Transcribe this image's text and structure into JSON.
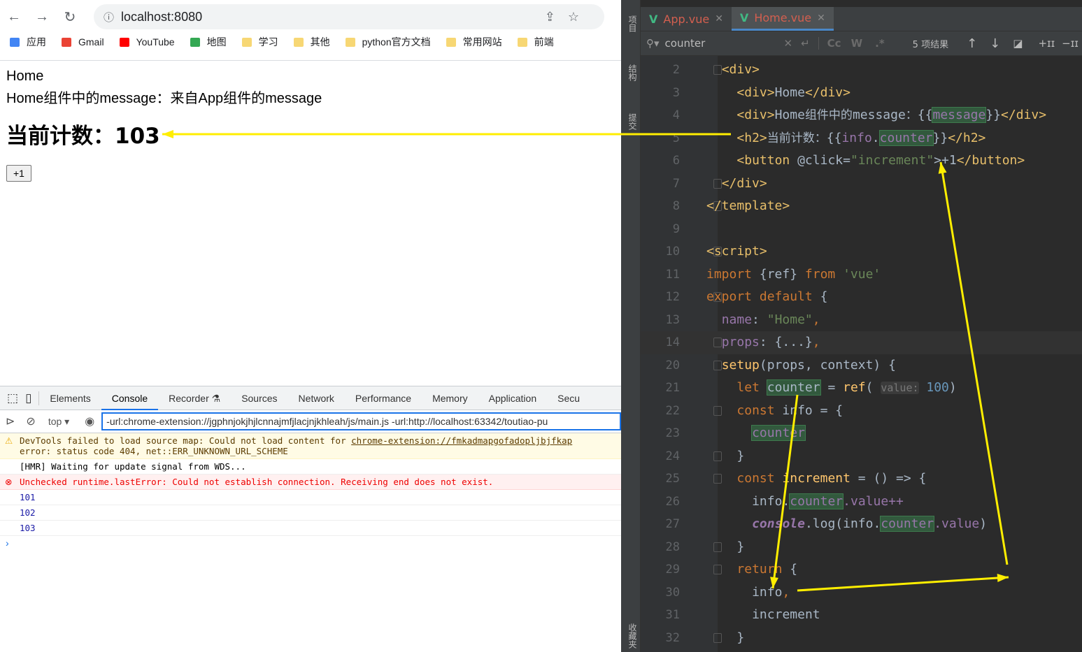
{
  "browser": {
    "url": "localhost:8080",
    "bookmarks": [
      {
        "label": "应用",
        "color": "#4285f4"
      },
      {
        "label": "Gmail",
        "color": "#ea4335"
      },
      {
        "label": "YouTube",
        "color": "#ff0000"
      },
      {
        "label": "地图",
        "color": "#34a853"
      },
      {
        "label": "学习",
        "color": "#f7d774"
      },
      {
        "label": "其他",
        "color": "#f7d774"
      },
      {
        "label": "python官方文档",
        "color": "#f7d774"
      },
      {
        "label": "常用网站",
        "color": "#f7d774"
      },
      {
        "label": "前端",
        "color": "#f7d774"
      }
    ]
  },
  "page": {
    "title": "Home",
    "message_line": "Home组件中的message：来自App组件的message",
    "counter_heading": "当前计数：103",
    "button": "+1"
  },
  "devtools": {
    "tabs": [
      "Elements",
      "Console",
      "Recorder ⚗",
      "Sources",
      "Network",
      "Performance",
      "Memory",
      "Application",
      "Secu"
    ],
    "active_tab": "Console",
    "context": "top ▾",
    "filter": "-url:chrome-extension://jgphnjokjhjlcnnajmfjlacjnjkhleah/js/main.js -url:http://localhost:63342/toutiao-pu",
    "messages": [
      {
        "type": "warn",
        "text": "DevTools failed to load source map: Could not load content for ",
        "link": "chrome-extension://fmkadmapgofadopljbjfkap",
        "text2": "error: status code 404, net::ERR_UNKNOWN_URL_SCHEME"
      },
      {
        "type": "log",
        "text": "[HMR] Waiting for update signal from WDS..."
      },
      {
        "type": "err",
        "text": "Unchecked runtime.lastError: Could not establish connection. Receiving end does not exist."
      },
      {
        "type": "num",
        "text": "101"
      },
      {
        "type": "num",
        "text": "102"
      },
      {
        "type": "num",
        "text": "103"
      }
    ]
  },
  "ide": {
    "side_labels": [
      "项目",
      "结构",
      "提交",
      "收藏夹"
    ],
    "tabs": [
      {
        "label": "App.vue",
        "active": false
      },
      {
        "label": "Home.vue",
        "active": true
      }
    ],
    "search": "counter",
    "results": "5 项结果",
    "option_buttons": [
      "Cc",
      "W",
      ".*"
    ],
    "lines": [
      {
        "n": "2",
        "i": 2,
        "f": 1,
        "t": [
          [
            "<div>",
            "tag"
          ]
        ]
      },
      {
        "n": "3",
        "i": 4,
        "t": [
          [
            "<div>",
            "tag"
          ],
          [
            "Home",
            "plain"
          ],
          [
            "</div>",
            "tag"
          ]
        ]
      },
      {
        "n": "4",
        "i": 4,
        "t": [
          [
            "<div>",
            "tag"
          ],
          [
            "Home",
            "plain"
          ],
          [
            "组件中的",
            "cn"
          ],
          [
            "message",
            "plain"
          ],
          [
            "：",
            "cn"
          ],
          [
            "{{",
            "plain"
          ],
          [
            "message",
            "fld hl"
          ],
          [
            "}}",
            "plain"
          ],
          [
            "</div>",
            "tag"
          ]
        ]
      },
      {
        "n": "5",
        "i": 4,
        "t": [
          [
            "<h2>",
            "tag"
          ],
          [
            "当前计数",
            "cn"
          ],
          [
            "：",
            "cn"
          ],
          [
            "{{",
            "plain"
          ],
          [
            "info",
            "fld"
          ],
          [
            ".",
            "plain"
          ],
          [
            "counter",
            "fld hl"
          ],
          [
            "}}",
            "plain"
          ],
          [
            "</h2>",
            "tag"
          ]
        ]
      },
      {
        "n": "6",
        "i": 4,
        "t": [
          [
            "<button ",
            "tag"
          ],
          [
            "@click=",
            "plain"
          ],
          [
            "\"increment\"",
            "str"
          ],
          [
            ">+1",
            "plain"
          ],
          [
            "</button>",
            "tag"
          ]
        ]
      },
      {
        "n": "7",
        "i": 2,
        "f": 1,
        "t": [
          [
            "</div>",
            "tag"
          ]
        ]
      },
      {
        "n": "8",
        "i": 0,
        "f": 1,
        "t": [
          [
            "</template>",
            "tag"
          ]
        ]
      },
      {
        "n": "9",
        "i": 0,
        "t": []
      },
      {
        "n": "10",
        "i": 0,
        "f": 1,
        "t": [
          [
            "<script>",
            "tag"
          ]
        ]
      },
      {
        "n": "11",
        "i": 0,
        "t": [
          [
            "import ",
            "kw"
          ],
          [
            "{ref} ",
            "plain"
          ],
          [
            "from ",
            "kw"
          ],
          [
            "'vue'",
            "str"
          ]
        ]
      },
      {
        "n": "12",
        "i": 0,
        "f": 1,
        "t": [
          [
            "export default ",
            "kw"
          ],
          [
            "{",
            "plain"
          ]
        ]
      },
      {
        "n": "13",
        "i": 2,
        "t": [
          [
            "name",
            "fld"
          ],
          [
            ": ",
            "plain"
          ],
          [
            "\"Home\"",
            "str"
          ],
          [
            ",",
            "kw"
          ]
        ]
      },
      {
        "n": "14",
        "i": 2,
        "f": 1,
        "c": 1,
        "t": [
          [
            "props",
            "fld"
          ],
          [
            ": ",
            "plain"
          ],
          [
            "{...}",
            "plain"
          ],
          [
            ",",
            "kw"
          ]
        ]
      },
      {
        "n": "20",
        "i": 2,
        "f": 1,
        "t": [
          [
            "setup",
            "fn"
          ],
          [
            "(props, context) ",
            "plain"
          ],
          [
            "{",
            "plain"
          ]
        ]
      },
      {
        "n": "21",
        "i": 4,
        "t": [
          [
            "let ",
            "kw"
          ],
          [
            "counter",
            "plain hl"
          ],
          [
            " = ",
            "plain"
          ],
          [
            "ref",
            "fn"
          ],
          [
            "( ",
            "plain"
          ],
          [
            "value:",
            "hint"
          ],
          [
            " 100",
            "num2"
          ],
          [
            ")",
            "plain"
          ]
        ]
      },
      {
        "n": "22",
        "i": 4,
        "f": 1,
        "t": [
          [
            "const ",
            "kw"
          ],
          [
            "info = {",
            "plain"
          ]
        ]
      },
      {
        "n": "23",
        "i": 6,
        "t": [
          [
            "counter",
            "fld hl"
          ]
        ]
      },
      {
        "n": "24",
        "i": 4,
        "f": 1,
        "t": [
          [
            "}",
            "plain"
          ]
        ]
      },
      {
        "n": "25",
        "i": 4,
        "f": 1,
        "t": [
          [
            "const ",
            "kw"
          ],
          [
            "increment",
            "fn"
          ],
          [
            " = () => {",
            "plain"
          ]
        ]
      },
      {
        "n": "26",
        "i": 6,
        "t": [
          [
            "info.",
            "plain"
          ],
          [
            "counter",
            "fld hl"
          ],
          [
            ".value++",
            "fld"
          ]
        ]
      },
      {
        "n": "27",
        "i": 6,
        "t": [
          [
            "console",
            "it"
          ],
          [
            ".log(info.",
            "plain"
          ],
          [
            "counter",
            "fld hl"
          ],
          [
            ".value",
            "fld"
          ],
          [
            ")",
            "plain"
          ]
        ]
      },
      {
        "n": "28",
        "i": 4,
        "f": 1,
        "t": [
          [
            "}",
            "plain"
          ]
        ]
      },
      {
        "n": "29",
        "i": 4,
        "f": 1,
        "t": [
          [
            "return ",
            "kw"
          ],
          [
            "{",
            "plain"
          ]
        ]
      },
      {
        "n": "30",
        "i": 6,
        "t": [
          [
            "info",
            "plain"
          ],
          [
            ",",
            "kw"
          ]
        ]
      },
      {
        "n": "31",
        "i": 6,
        "t": [
          [
            "increment",
            "plain"
          ]
        ]
      },
      {
        "n": "32",
        "i": 4,
        "f": 1,
        "t": [
          [
            "}",
            "plain"
          ]
        ]
      }
    ]
  },
  "annotation_color": "#ffee00"
}
